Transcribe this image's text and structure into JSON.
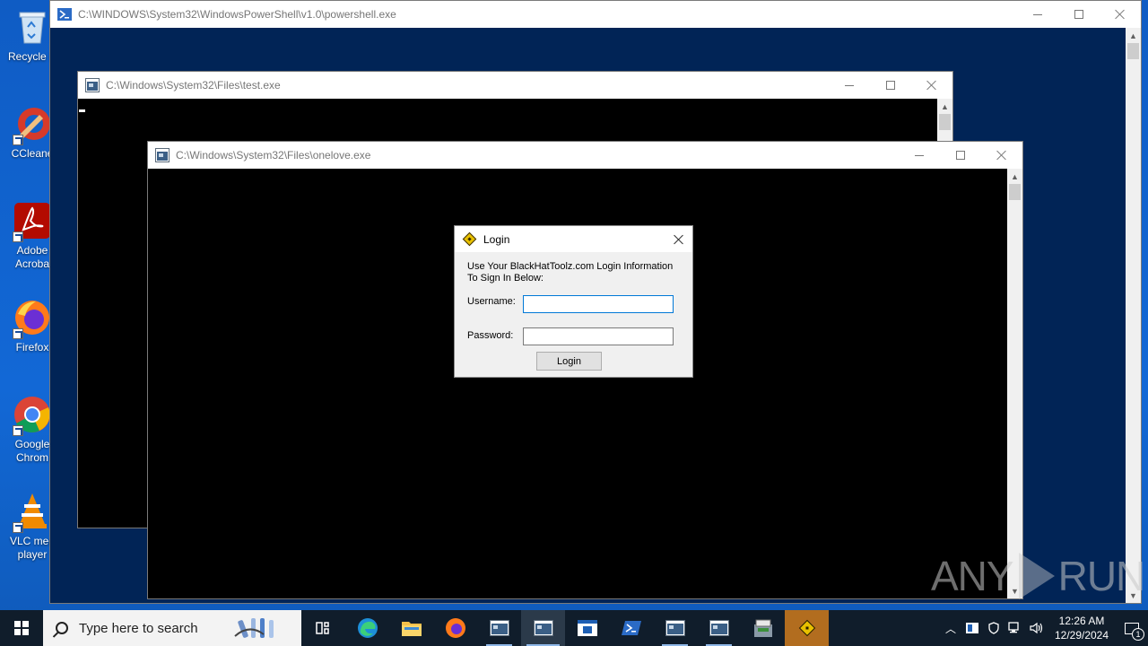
{
  "desktop": {
    "icons": [
      {
        "label": "Recycle Bin",
        "visible_label": "Recycle B"
      },
      {
        "label": "CCleaner",
        "visible_label": "CCleane"
      },
      {
        "label": "Adobe Acrobat",
        "visible_label": "Adobe Acroba"
      },
      {
        "label": "Firefox",
        "visible_label": "Firefox"
      },
      {
        "label": "Google Chrome",
        "visible_label": "Google Chrom"
      },
      {
        "label": "VLC media player",
        "visible_label": "VLC med player"
      }
    ]
  },
  "windows": {
    "powershell": {
      "title": "C:\\WINDOWS\\System32\\WindowsPowerShell\\v1.0\\powershell.exe"
    },
    "test": {
      "title": "C:\\Windows\\System32\\Files\\test.exe"
    },
    "onelove": {
      "title": "C:\\Windows\\System32\\Files\\onelove.exe"
    }
  },
  "login_dialog": {
    "title": "Login",
    "message": "Use Your BlackHatToolz.com Login Information To Sign In Below:",
    "username_label": "Username:",
    "username_value": "",
    "password_label": "Password:",
    "password_value": "",
    "login_button": "Login"
  },
  "watermark": {
    "left": "ANY",
    "right": "RUN"
  },
  "taskbar": {
    "search_placeholder": "Type here to search",
    "apps": [
      "task-view",
      "edge",
      "file-explorer",
      "firefox",
      "console",
      "console",
      "app-window",
      "powershell",
      "console",
      "console",
      "installer",
      "login-app"
    ],
    "clock_time": "12:26 AM",
    "clock_date": "12/29/2024",
    "notification_count": "1"
  },
  "colors": {
    "desktop_bg": "#1160c8",
    "powershell_bg": "#012456",
    "console_bg": "#000000",
    "taskbar_bg": "#101d2b",
    "accent": "#0078d7"
  }
}
